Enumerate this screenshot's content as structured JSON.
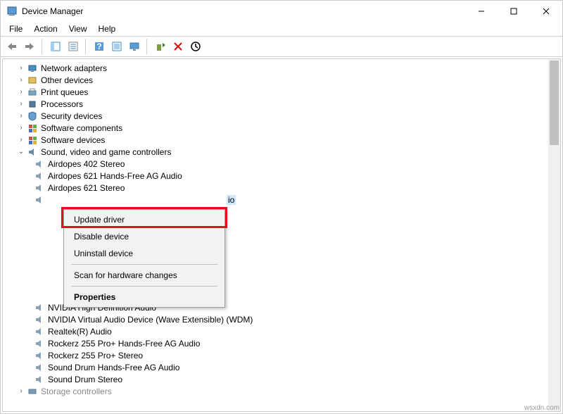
{
  "window": {
    "title": "Device Manager"
  },
  "menu": {
    "file": "File",
    "action": "Action",
    "view": "View",
    "help": "Help"
  },
  "tree": {
    "categories": [
      {
        "icon": "network",
        "label": "Network adapters"
      },
      {
        "icon": "other",
        "label": "Other devices"
      },
      {
        "icon": "printer",
        "label": "Print queues"
      },
      {
        "icon": "cpu",
        "label": "Processors"
      },
      {
        "icon": "security",
        "label": "Security devices"
      },
      {
        "icon": "software",
        "label": "Software components"
      },
      {
        "icon": "software",
        "label": "Software devices"
      }
    ],
    "expanded": {
      "label": "Sound, video and game controllers",
      "items": [
        "Airdopes 402 Stereo",
        "Airdopes 621 Hands-Free AG Audio",
        "Airdopes 621 Stereo"
      ],
      "selected_suffix": "io",
      "items_after": [
        "NVIDIA High Definition Audio",
        "NVIDIA Virtual Audio Device (Wave Extensible) (WDM)",
        "Realtek(R) Audio",
        "Rockerz 255 Pro+ Hands-Free AG Audio",
        "Rockerz 255 Pro+ Stereo",
        "Sound Drum Hands-Free AG Audio",
        "Sound Drum Stereo"
      ]
    },
    "last": {
      "label": "Storage controllers"
    }
  },
  "context_menu": {
    "update": "Update driver",
    "disable": "Disable device",
    "uninstall": "Uninstall device",
    "scan": "Scan for hardware changes",
    "properties": "Properties"
  },
  "watermark": "wsxdn.com"
}
